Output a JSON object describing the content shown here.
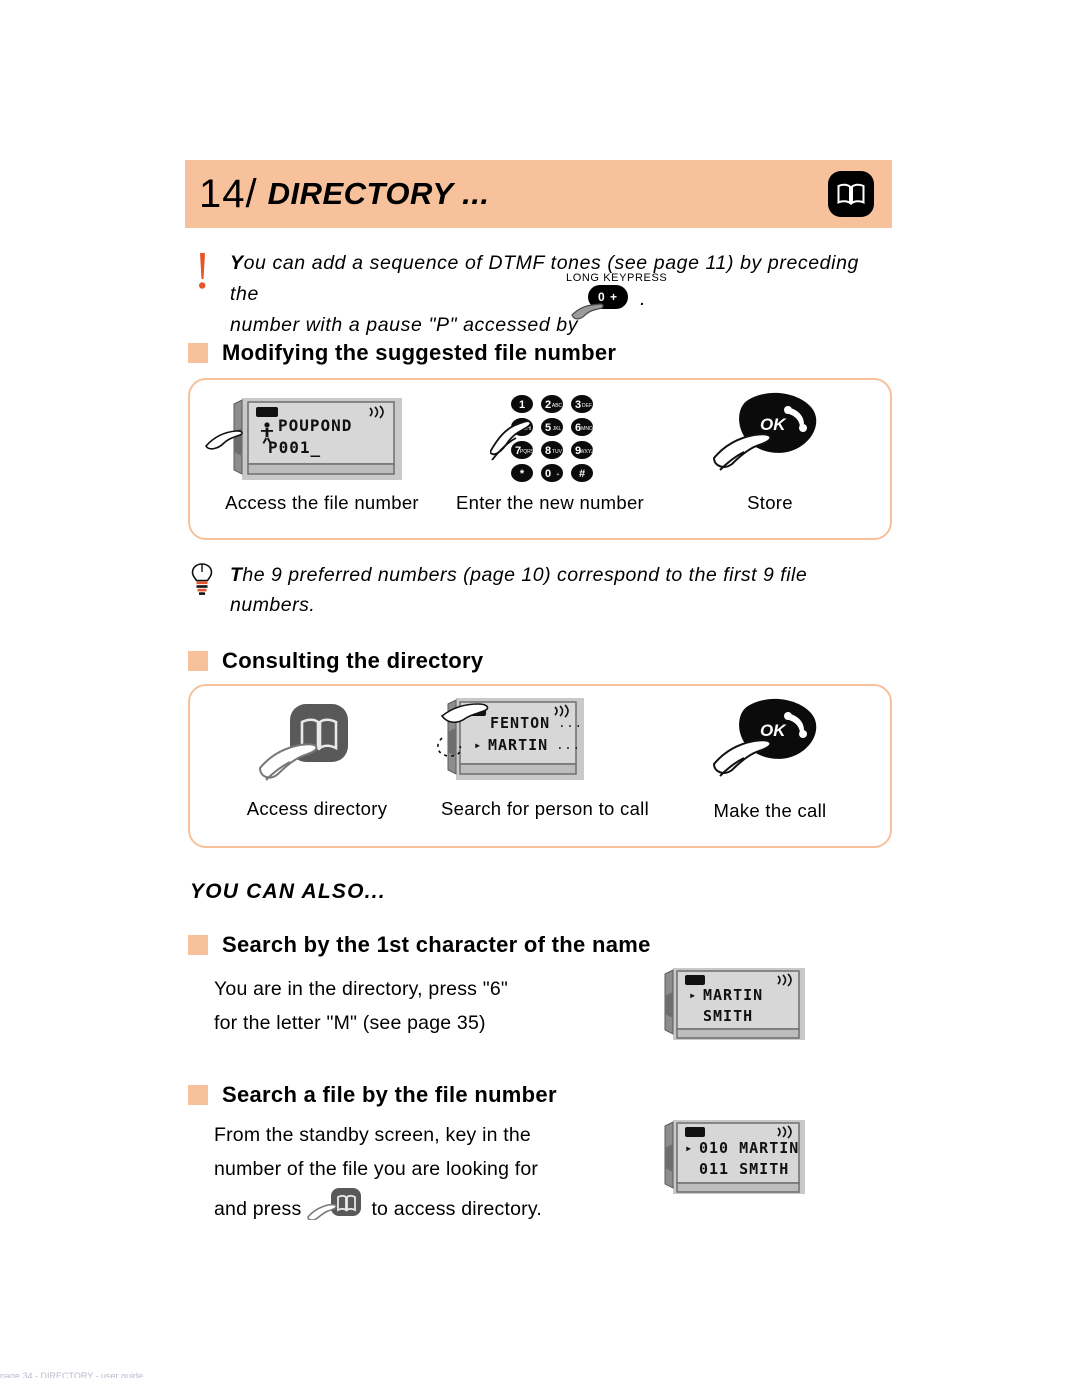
{
  "page": {
    "chapter_number": "14/",
    "chapter_title": "DIRECTORY ...",
    "header_icon": "book-icon",
    "background_color": "#ffffff",
    "accent_color": "#f7c19c",
    "footer_note": "page 34  -  DIRECTORY  -  user guide"
  },
  "warning_note": {
    "icon": "exclamation-icon",
    "lead_char": "Y",
    "line1_rest": "ou can add a sequence of DTMF tones (see page 11) by preceding the",
    "line2": "number with a pause \"P\" accessed by",
    "keypress_label": "LONG KEYPRESS",
    "key_label": "0 +",
    "trailing_period": "."
  },
  "section_modify": {
    "heading": "Modifying the suggested file number",
    "steps": [
      {
        "caption": "Access the file number",
        "visual": "phone-lcd-with-hand",
        "lcd_line1": "POUPOND",
        "lcd_line2": "P001_",
        "lcd_prefix_icon": "person-icon"
      },
      {
        "caption": "Enter the new number",
        "visual": "keypad-with-hand",
        "keys": [
          {
            "digit": "1",
            "letters": ""
          },
          {
            "digit": "2",
            "letters": "ABC"
          },
          {
            "digit": "3",
            "letters": "DEF"
          },
          {
            "digit": "4",
            "letters": "GHI"
          },
          {
            "digit": "5",
            "letters": "JKL"
          },
          {
            "digit": "6",
            "letters": "MNO"
          },
          {
            "digit": "7",
            "letters": "PQRS"
          },
          {
            "digit": "8",
            "letters": "TUV"
          },
          {
            "digit": "9",
            "letters": "WXYZ"
          },
          {
            "digit": "*",
            "letters": ""
          },
          {
            "digit": "0",
            "letters": "+"
          },
          {
            "digit": "#",
            "letters": ""
          }
        ]
      },
      {
        "caption": "Store",
        "visual": "ok-key-with-hand",
        "key_label": "OK"
      }
    ]
  },
  "tip_note": {
    "icon": "lightbulb-icon",
    "lead_char": "T",
    "text_rest": "he 9 preferred numbers (page 10) correspond to the first 9 file numbers."
  },
  "section_consult": {
    "heading": "Consulting the directory",
    "steps": [
      {
        "caption": "Access directory",
        "visual": "book-key-with-hand",
        "key_icon": "book-icon"
      },
      {
        "caption": "Search for person to call",
        "visual": "phone-lcd-list-with-hand",
        "lcd_rows": [
          {
            "marker": "",
            "name": "FENTON",
            "trail": "..."
          },
          {
            "marker": "▸",
            "name": "MARTIN",
            "trail": "..."
          }
        ]
      },
      {
        "caption": "Make the call",
        "visual": "ok-key-with-hand",
        "key_label": "OK"
      }
    ]
  },
  "you_can_also": {
    "label": "YOU CAN ALSO...",
    "blocks": [
      {
        "heading": "Search by the 1st character of the name",
        "lines": [
          "You are in the directory, press \"6\"",
          "for the letter \"M\" (see page 35)"
        ],
        "lcd_rows": [
          {
            "marker": "▸",
            "name": "MARTIN"
          },
          {
            "marker": "",
            "name": "SMITH"
          }
        ]
      },
      {
        "heading": "Search a file by the file number",
        "lines": [
          "From the standby screen, key in the",
          "number of the file you are looking for",
          "and press",
          "to access directory."
        ],
        "inline_icon": "book-icon",
        "lcd_rows": [
          {
            "marker": "▸",
            "name": "010 MARTIN"
          },
          {
            "marker": "",
            "name": "011 SMITH"
          }
        ]
      }
    ]
  }
}
